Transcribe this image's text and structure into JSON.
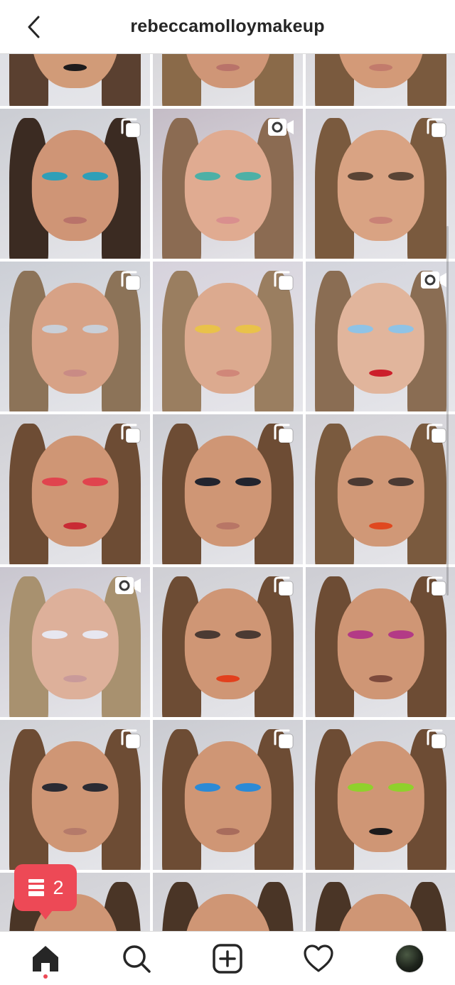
{
  "header": {
    "title": "rebeccamolloymakeup",
    "back_icon": "chevron-left-icon"
  },
  "grid": {
    "posts": [
      {
        "type": "post",
        "badge": "none",
        "bg": "#d7d9e0",
        "skin": "#d19b78",
        "hair": "#5a4030",
        "eye": "#2f8a3e",
        "lips": "#1d1b1c"
      },
      {
        "type": "post",
        "badge": "none",
        "bg": "#cbc9cc",
        "skin": "#cf9677",
        "hair": "#8a6a49",
        "eye": "#4b3a33",
        "lips": "#b9736a"
      },
      {
        "type": "post",
        "badge": "none",
        "bg": "#d0cfd3",
        "skin": "#d39a78",
        "hair": "#7a5a3e",
        "eye": "#5a4435",
        "lips": "#c27b6c"
      },
      {
        "type": "carousel",
        "badge": "carousel-icon",
        "bg": "#cbcdd3",
        "skin": "#cf9576",
        "hair": "#3b2b22",
        "eye": "#2f9fb8",
        "lips": "#b9736a"
      },
      {
        "type": "video",
        "badge": "video-icon",
        "bg": "#c4bcc6",
        "skin": "#e0ab91",
        "hair": "#8b6b52",
        "eye": "#4db0a6",
        "lips": "#d98f8e"
      },
      {
        "type": "carousel",
        "badge": "carousel-icon",
        "bg": "#d3d2d9",
        "skin": "#d9a383",
        "hair": "#7a5a3e",
        "eye": "#5a4435",
        "lips": "#c98276"
      },
      {
        "type": "carousel",
        "badge": "carousel-icon",
        "bg": "#cccfd6",
        "skin": "#d7a286",
        "hair": "#8c7358",
        "eye": "#c9cfd8",
        "lips": "#c98b85"
      },
      {
        "type": "carousel",
        "badge": "carousel-icon",
        "bg": "#d6d2dc",
        "skin": "#dcaa8f",
        "hair": "#9a7e60",
        "eye": "#e9c24a",
        "lips": "#d08779"
      },
      {
        "type": "video",
        "badge": "video-icon",
        "bg": "#d3d4dc",
        "skin": "#e1b59c",
        "hair": "#8a6d53",
        "eye": "#8fc3e6",
        "lips": "#cc1f2b"
      },
      {
        "type": "carousel",
        "badge": "carousel-icon",
        "bg": "#d0d0d5",
        "skin": "#cf9675",
        "hair": "#6d4c34",
        "eye": "#e0444e",
        "lips": "#c92b34"
      },
      {
        "type": "carousel",
        "badge": "carousel-icon",
        "bg": "#cbccd2",
        "skin": "#cf9675",
        "hair": "#6d4c34",
        "eye": "#22242e",
        "lips": "#b87666"
      },
      {
        "type": "carousel",
        "badge": "carousel-icon",
        "bg": "#d2d1d6",
        "skin": "#d09877",
        "hair": "#7a5a3e",
        "eye": "#4b3a33",
        "lips": "#e0481f"
      },
      {
        "type": "video",
        "badge": "video-icon",
        "bg": "#c9c6cf",
        "skin": "#ddb09a",
        "hair": "#a8916f",
        "eye": "#e7e7f0",
        "lips": "#c99a9a"
      },
      {
        "type": "carousel",
        "badge": "carousel-icon",
        "bg": "#cfcfd4",
        "skin": "#cf9675",
        "hair": "#6d4c34",
        "eye": "#4b3a33",
        "lips": "#e2401d"
      },
      {
        "type": "carousel",
        "badge": "carousel-icon",
        "bg": "#cdcdd3",
        "skin": "#cf9675",
        "hair": "#6d4c34",
        "eye": "#b33a86",
        "lips": "#7d4a3c"
      },
      {
        "type": "carousel",
        "badge": "carousel-icon",
        "bg": "#d0d1d6",
        "skin": "#cf9675",
        "hair": "#6d4c34",
        "eye": "#2b2b33",
        "lips": "#b57a6a"
      },
      {
        "type": "carousel",
        "badge": "carousel-icon",
        "bg": "#cacbd1",
        "skin": "#cf9675",
        "hair": "#6d4c34",
        "eye": "#2b8ad6",
        "lips": "#a86c5c"
      },
      {
        "type": "carousel",
        "badge": "carousel-icon",
        "bg": "#cfd0d6",
        "skin": "#cf9675",
        "hair": "#6d4c34",
        "eye": "#8fd12c",
        "lips": "#1d1b1c"
      },
      {
        "type": "post",
        "badge": "none",
        "bg": "#cfcfd4",
        "skin": "#cf9675",
        "hair": "#4a3526",
        "eye": "#4b3a33",
        "lips": "#b57a6a"
      },
      {
        "type": "post",
        "badge": "none",
        "bg": "#cfcfd4",
        "skin": "#cf9675",
        "hair": "#4a3526",
        "eye": "#4b3a33",
        "lips": "#b57a6a"
      },
      {
        "type": "post",
        "badge": "none",
        "bg": "#cfcfd4",
        "skin": "#cf9675",
        "hair": "#4a3526",
        "eye": "#4b3a33",
        "lips": "#b57a6a"
      }
    ]
  },
  "notification": {
    "icon": "posts-stack-icon",
    "count": "2",
    "color": "#ed4956"
  },
  "tabbar": {
    "items": [
      {
        "name": "home",
        "icon": "home-icon"
      },
      {
        "name": "search",
        "icon": "search-icon"
      },
      {
        "name": "new-post",
        "icon": "add-post-icon"
      },
      {
        "name": "activity",
        "icon": "heart-icon"
      },
      {
        "name": "profile",
        "icon": "profile-avatar"
      }
    ]
  }
}
